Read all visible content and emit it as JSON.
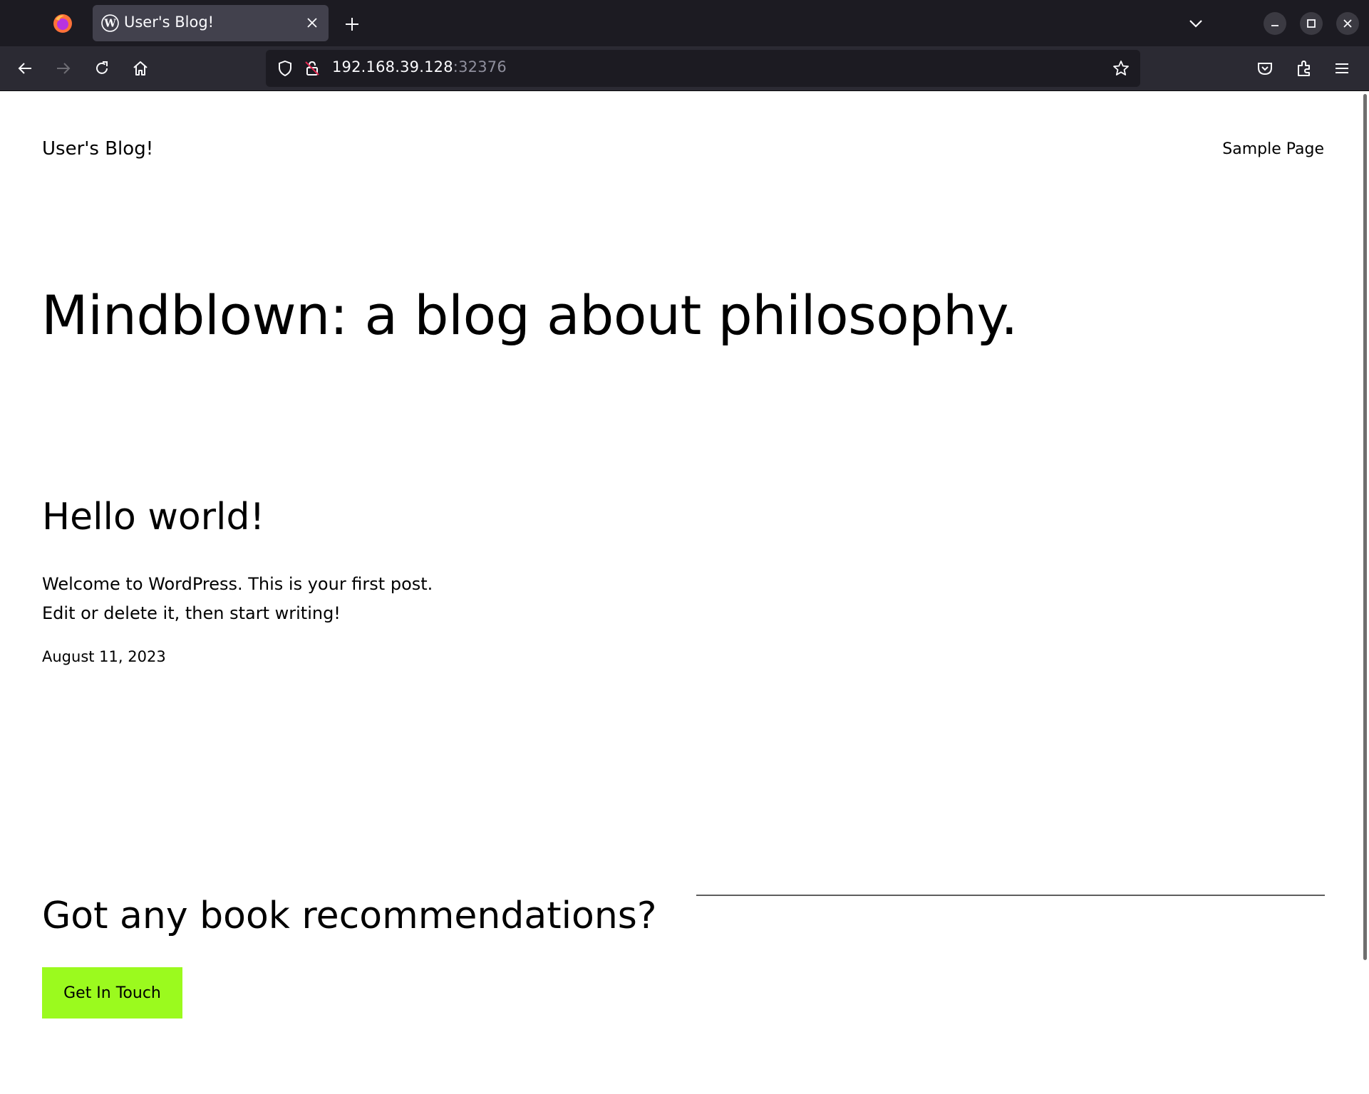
{
  "browser": {
    "tab": {
      "title": "User's Blog!"
    },
    "url": {
      "host": "192.168.39.128",
      "port": ":32376"
    },
    "icons": {
      "app": "firefox-logo-icon",
      "favicon": "wordpress-icon",
      "tab_close": "close-icon",
      "new_tab": "plus-icon",
      "tab_list": "chevron-down-icon",
      "minimize": "minimize-icon",
      "maximize": "maximize-icon",
      "close_window": "close-icon",
      "back": "arrow-left-icon",
      "forward": "arrow-right-icon",
      "reload": "reload-icon",
      "home": "home-icon",
      "tracking": "shield-icon",
      "insecure": "lock-strike-icon",
      "bookmark": "star-icon",
      "pocket": "pocket-icon",
      "extensions": "puzzle-icon",
      "menu": "hamburger-menu-icon"
    },
    "colors": {
      "tabbar": "#1c1b22",
      "toolbar": "#2b2a33",
      "tab_active": "#42414d"
    }
  },
  "site": {
    "title": "User's Blog!",
    "nav": {
      "sample_page": "Sample Page"
    },
    "tagline": "Mindblown: a blog about philosophy."
  },
  "post": {
    "title": "Hello world!",
    "body_line1": "Welcome to WordPress. This is your first post.",
    "body_line2": "Edit or delete it, then start writing!",
    "date": "August 11, 2023"
  },
  "cta": {
    "heading": "Got any book recommendations?",
    "button_label": "Get In Touch",
    "button_color": "#9bfa1e"
  }
}
